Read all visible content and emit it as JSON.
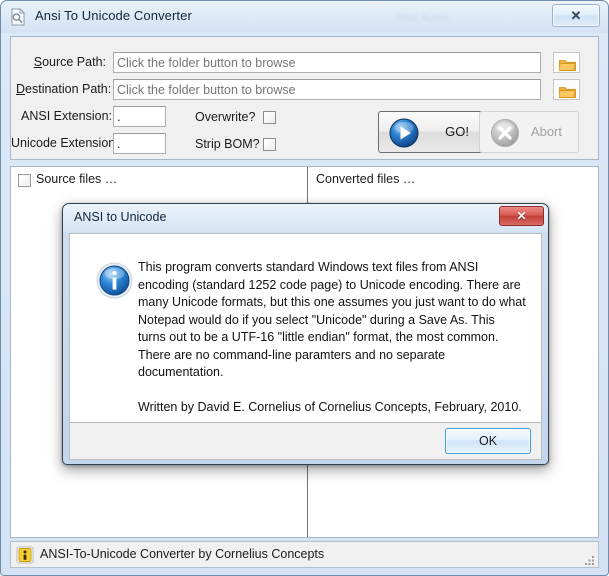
{
  "window": {
    "title": "Ansi To Unicode Converter",
    "watermark": "Stop Autos",
    "icon": "document-icon",
    "close_label": "✕"
  },
  "form": {
    "source_path": {
      "label_prefix": "S",
      "label_rest": "ource Path:",
      "placeholder": "Click the folder button to browse",
      "value": "",
      "browse_icon": "folder-icon"
    },
    "destination_path": {
      "label_prefix": "D",
      "label_rest": "estination Path:",
      "placeholder": "Click the folder button to browse",
      "value": "",
      "browse_icon": "folder-icon"
    },
    "ansi_extension": {
      "label": "ANSI Extension:",
      "value": "."
    },
    "unicode_extension": {
      "label": "Unicode Extension:",
      "value": "."
    },
    "overwrite": {
      "label": "Overwrite?",
      "checked": false
    },
    "strip_bom": {
      "label": "Strip BOM?",
      "checked": false
    },
    "go_button": {
      "label": "GO!",
      "icon": "play-circle-icon",
      "enabled": true
    },
    "abort_button": {
      "label": "Abort",
      "icon": "cancel-circle-icon",
      "enabled": false
    }
  },
  "lists": {
    "source": {
      "header": "Source files …",
      "select_all_checked": false,
      "items": []
    },
    "converted": {
      "header": "Converted files …",
      "items": []
    }
  },
  "status_bar": {
    "icon": "info-yellow-icon",
    "text": "ANSI-To-Unicode Converter by Cornelius Concepts"
  },
  "dialog": {
    "title": "ANSI to Unicode",
    "close_label": "✕",
    "icon": "info-blue-icon",
    "paragraph_1": "This program converts standard Windows text files from ANSI encoding (standard 1252 code page) to Unicode encoding. There are many Unicode formats, but this one assumes you just want to do what Notepad would do if you select \"Unicode\" during a Save As.  This turns out to be a UTF-16 \"little endian\" format, the most common. There are no command-line paramters and no separate documentation.",
    "paragraph_2": "Written by David E. Cornelius of Cornelius Concepts, February, 2010.",
    "ok_button": "OK"
  },
  "colors": {
    "accent_blue": "#3c9fd6",
    "close_red": "#c33f38",
    "folder_orange": "#f0a830",
    "info_blue": "#1d72c4",
    "window_chrome": "#d4e3f4"
  }
}
